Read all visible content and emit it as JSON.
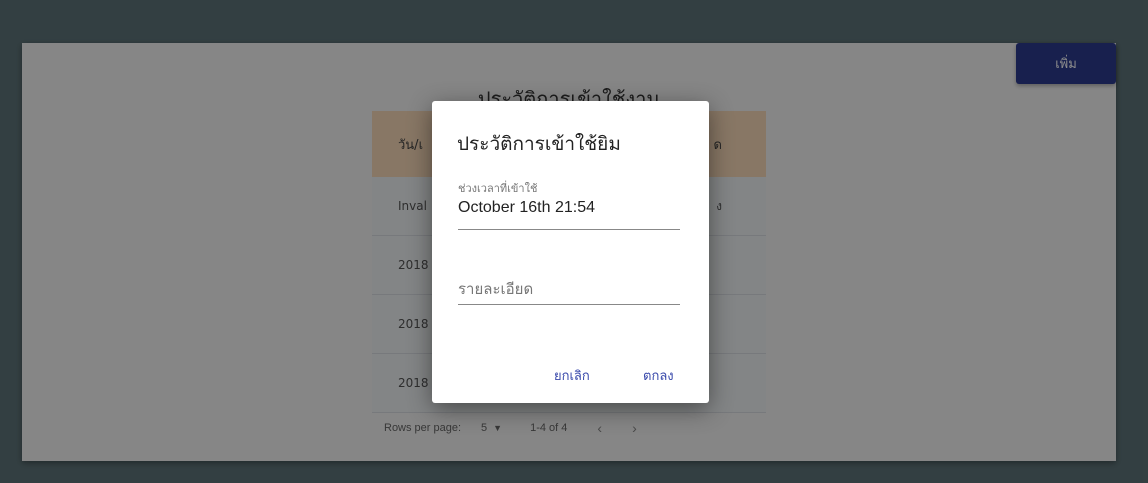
{
  "toolbar": {
    "add_label": "เพิ่ม"
  },
  "background_page": {
    "title": "ประวัติการเข้าใช้งาน",
    "table": {
      "headers": [
        "วัน/เ",
        "ด"
      ],
      "rows": [
        [
          "Inval",
          "ง"
        ],
        [
          "2018",
          ""
        ],
        [
          "2018",
          ""
        ],
        [
          "2018",
          ""
        ]
      ]
    },
    "pagination": {
      "rows_per_page_label": "Rows per page:",
      "rows_per_page_value": "5",
      "range": "1-4 of 4",
      "prev": "‹",
      "next": "›"
    }
  },
  "dialog": {
    "title": "ประวัติการเข้าใช้ยิม",
    "period_label": "ช่วงเวลาที่เข้าใช้",
    "period_value": "October 16th 21:54",
    "detail_placeholder": "รายละเอียด",
    "cancel_label": "ยกเลิก",
    "ok_label": "ตกลง"
  }
}
